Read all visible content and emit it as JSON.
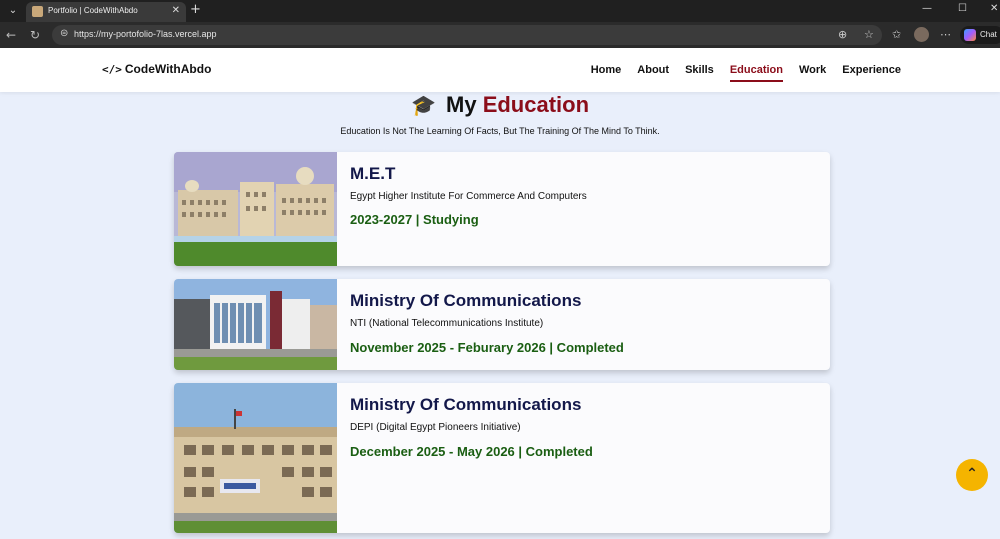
{
  "browser": {
    "tab_title": "Portfolio | CodeWithAbdo",
    "url": "https://my-portofolio-7las.vercel.app",
    "chat_label": "Chat"
  },
  "header": {
    "brand": "CodeWithAbdo",
    "nav": [
      {
        "label": "Home",
        "active": false
      },
      {
        "label": "About",
        "active": false
      },
      {
        "label": "Skills",
        "active": false
      },
      {
        "label": "Education",
        "active": true
      },
      {
        "label": "Work",
        "active": false
      },
      {
        "label": "Experience",
        "active": false
      }
    ]
  },
  "section": {
    "title_part1": "My",
    "title_part2": "Education",
    "quote": "Education Is Not The Learning Of Facts, But The Training Of The Mind To Think."
  },
  "education": [
    {
      "name": "M.E.T",
      "institution": "Egypt Higher Institute For Commerce And Computers",
      "date": "2023-2027 | Studying"
    },
    {
      "name": "Ministry Of Communications",
      "institution": "NTI (National Telecommunications Institute)",
      "date": "November 2025 - Feburary 2026 | Completed"
    },
    {
      "name": "Ministry Of Communications",
      "institution": "DEPI (Digital Egypt Pioneers Initiative)",
      "date": "December 2025 - May 2026 | Completed"
    }
  ],
  "colors": {
    "accent": "#8b0d1a",
    "title": "#13184a",
    "date": "#1a5e12",
    "scroll_button": "#f5b400"
  },
  "icons": [
    "graduation-cap-icon",
    "code-icon",
    "chevron-up-icon"
  ]
}
